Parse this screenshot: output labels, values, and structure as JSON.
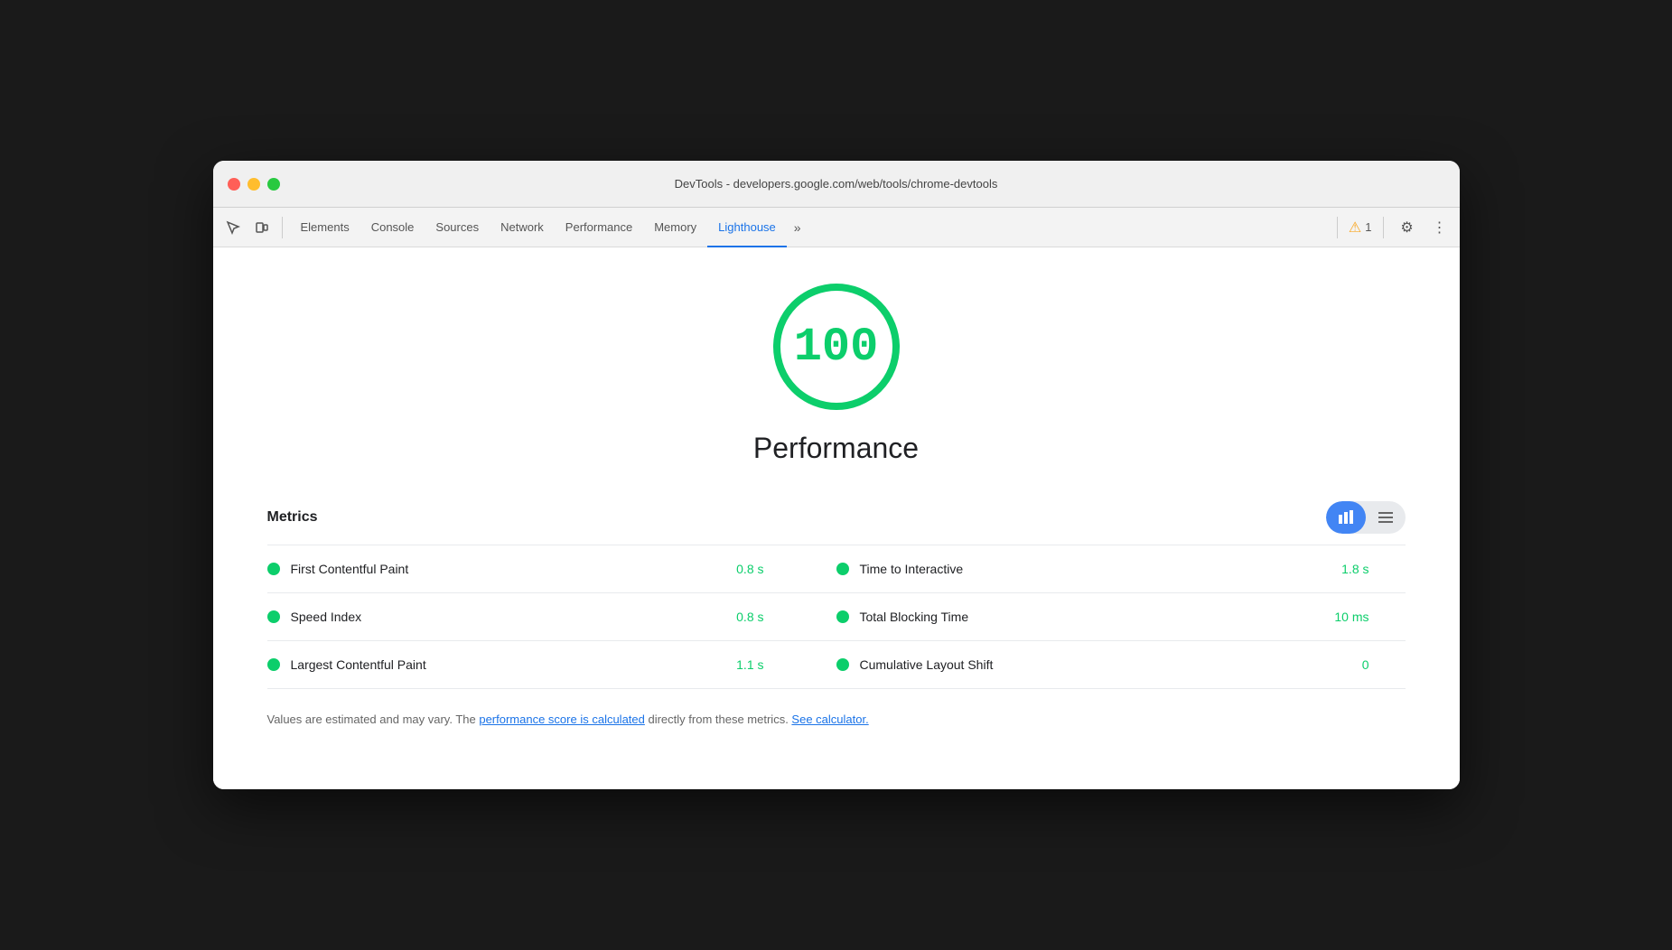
{
  "window": {
    "title": "DevTools - developers.google.com/web/tools/chrome-devtools"
  },
  "toolbar": {
    "tabs": [
      {
        "id": "elements",
        "label": "Elements",
        "active": false
      },
      {
        "id": "console",
        "label": "Console",
        "active": false
      },
      {
        "id": "sources",
        "label": "Sources",
        "active": false
      },
      {
        "id": "network",
        "label": "Network",
        "active": false
      },
      {
        "id": "performance",
        "label": "Performance",
        "active": false
      },
      {
        "id": "memory",
        "label": "Memory",
        "active": false
      },
      {
        "id": "lighthouse",
        "label": "Lighthouse",
        "active": true
      }
    ],
    "overflow_label": "»",
    "warning_count": "1",
    "settings_label": "⚙",
    "more_label": "⋮"
  },
  "score": {
    "value": "100",
    "title": "Performance"
  },
  "metrics": {
    "section_title": "Metrics",
    "items": [
      {
        "name": "First Contentful Paint",
        "value": "0.8 s",
        "col": 0
      },
      {
        "name": "Time to Interactive",
        "value": "1.8 s",
        "col": 1
      },
      {
        "name": "Speed Index",
        "value": "0.8 s",
        "col": 0
      },
      {
        "name": "Total Blocking Time",
        "value": "10 ms",
        "col": 1
      },
      {
        "name": "Largest Contentful Paint",
        "value": "1.1 s",
        "col": 0
      },
      {
        "name": "Cumulative Layout Shift",
        "value": "0",
        "col": 1
      }
    ]
  },
  "footer": {
    "text_before": "Values are estimated and may vary. The ",
    "link1_text": "performance score is calculated",
    "text_middle": " directly from these metrics. ",
    "link2_text": "See calculator.",
    "text_end": ""
  },
  "colors": {
    "green": "#0cce6b",
    "blue": "#4285f4",
    "text_dark": "#202124",
    "text_muted": "#666666"
  }
}
